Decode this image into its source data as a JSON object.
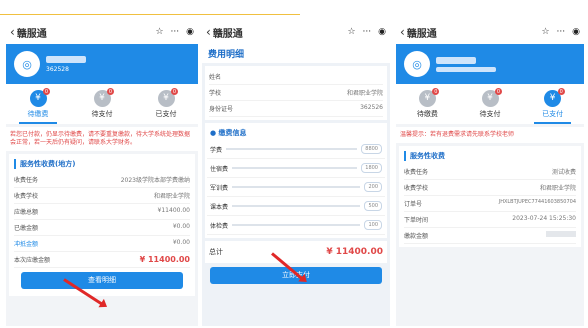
{
  "app_title": "赣服通",
  "nav_icons": [
    "star-icon",
    "more-icon",
    "target-icon"
  ],
  "user": {
    "id_masked": "362528"
  },
  "tabs": [
    {
      "label": "待缴费",
      "badge": "0"
    },
    {
      "label": "待支付",
      "badge": "0"
    },
    {
      "label": "已支付",
      "badge": "0"
    }
  ],
  "screen1": {
    "warning": "若您已付款，仍显示待缴费，请不要重复缴款，待大学系统处理数据会正常，若一天后仍有疑问，请联系大学财务。",
    "card_title": "服务性收费(地方)",
    "rows": [
      {
        "k": "收费任务",
        "v": "2023级学院本部学费缴纳"
      },
      {
        "k": "收费学校",
        "v": "和君职业学院"
      },
      {
        "k": "应缴总额",
        "v": "¥11400.00"
      },
      {
        "k": "已缴金额",
        "v": "¥0.00"
      },
      {
        "k": "冲抵金额",
        "v": "¥0.00"
      },
      {
        "k": "本次应缴金额",
        "v": "¥ 11400.00"
      }
    ],
    "button": "查看明细"
  },
  "screen2": {
    "title": "费用明细",
    "info": [
      {
        "k": "姓名",
        "v": ""
      },
      {
        "k": "学校",
        "v": "和君职业学院"
      },
      {
        "k": "身份证号",
        "v": "362526"
      }
    ],
    "items_title": "缴费信息",
    "items": [
      {
        "k": "学费",
        "v": "8800"
      },
      {
        "k": "住宿费",
        "v": "1800"
      },
      {
        "k": "军训费",
        "v": "200"
      },
      {
        "k": "课本费",
        "v": "500"
      },
      {
        "k": "体检费",
        "v": "100"
      }
    ],
    "total_label": "总计",
    "total_value": "¥ 11400.00",
    "button": "立即支付"
  },
  "screen3": {
    "warning": "温馨提示：若有退费需求请先联系学校老师",
    "card_title": "服务性收费",
    "rows": [
      {
        "k": "收费任务",
        "v": "测试收费"
      },
      {
        "k": "收费学校",
        "v": "和君职业学院"
      },
      {
        "k": "订单号",
        "v": "JHXLBTJUPEC77441603850704"
      },
      {
        "k": "下单时间",
        "v": "2023-07-24 15:25:30"
      },
      {
        "k": "缴款金额",
        "v": ""
      }
    ]
  },
  "colors": {
    "accent": "#1f8ae6",
    "warn": "#e04848"
  }
}
